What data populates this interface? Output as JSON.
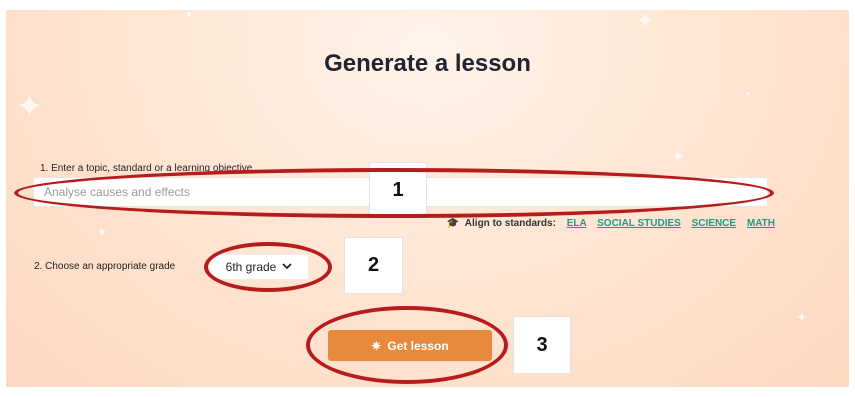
{
  "title": "Generate a lesson",
  "step1": {
    "label": "1. Enter a topic, standard or a learning objective",
    "placeholder": "Analyse causes and effects"
  },
  "align": {
    "label": "Align to standards:",
    "icon": "graduation-cap-icon",
    "links": [
      "ELA",
      "SOCIAL STUDIES",
      "SCIENCE",
      "MATH"
    ]
  },
  "step2": {
    "label": "2. Choose an appropriate grade",
    "selected": "6th grade",
    "icon": "chevron-down-icon"
  },
  "cta": {
    "label": "Get lesson",
    "icon": "magic-wand-icon"
  },
  "annotations": [
    "1",
    "2",
    "3"
  ],
  "colors": {
    "accent": "#e88a3c",
    "link": "#1f9a85",
    "annotation": "#b71c1c",
    "title": "#1f2430"
  }
}
